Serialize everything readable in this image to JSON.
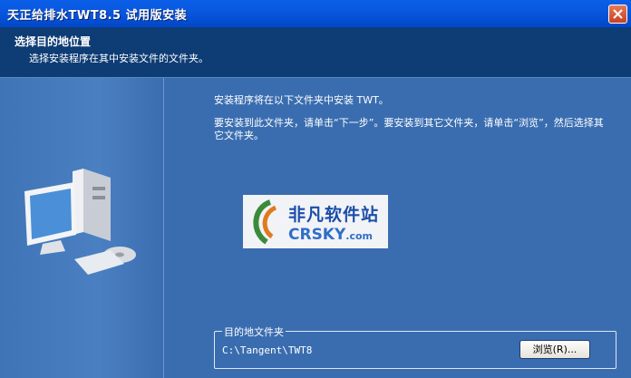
{
  "window": {
    "title": "天正给排水TWT8.5 试用版安装"
  },
  "header": {
    "title": "选择目的地位置",
    "subtitle": "选择安装程序在其中安装文件的文件夹。"
  },
  "main": {
    "instruction_1": "安装程序将在以下文件夹中安装 TWT。",
    "instruction_2": "要安装到此文件夹，请单击“下一步”。要安装到其它文件夹，请单击“浏览”，然后选择其它文件夹。",
    "watermark": {
      "cn": "非凡软件站",
      "en": "CRSKY",
      "en_suffix": ".com"
    }
  },
  "destination": {
    "group_label": "目的地文件夹",
    "path": "C:\\Tangent\\TWT8",
    "browse_label": "浏览(R)..."
  },
  "colors": {
    "titlebar": "#0a58de",
    "header_bg": "#0e3c74",
    "body_bg": "#3a6db0"
  }
}
